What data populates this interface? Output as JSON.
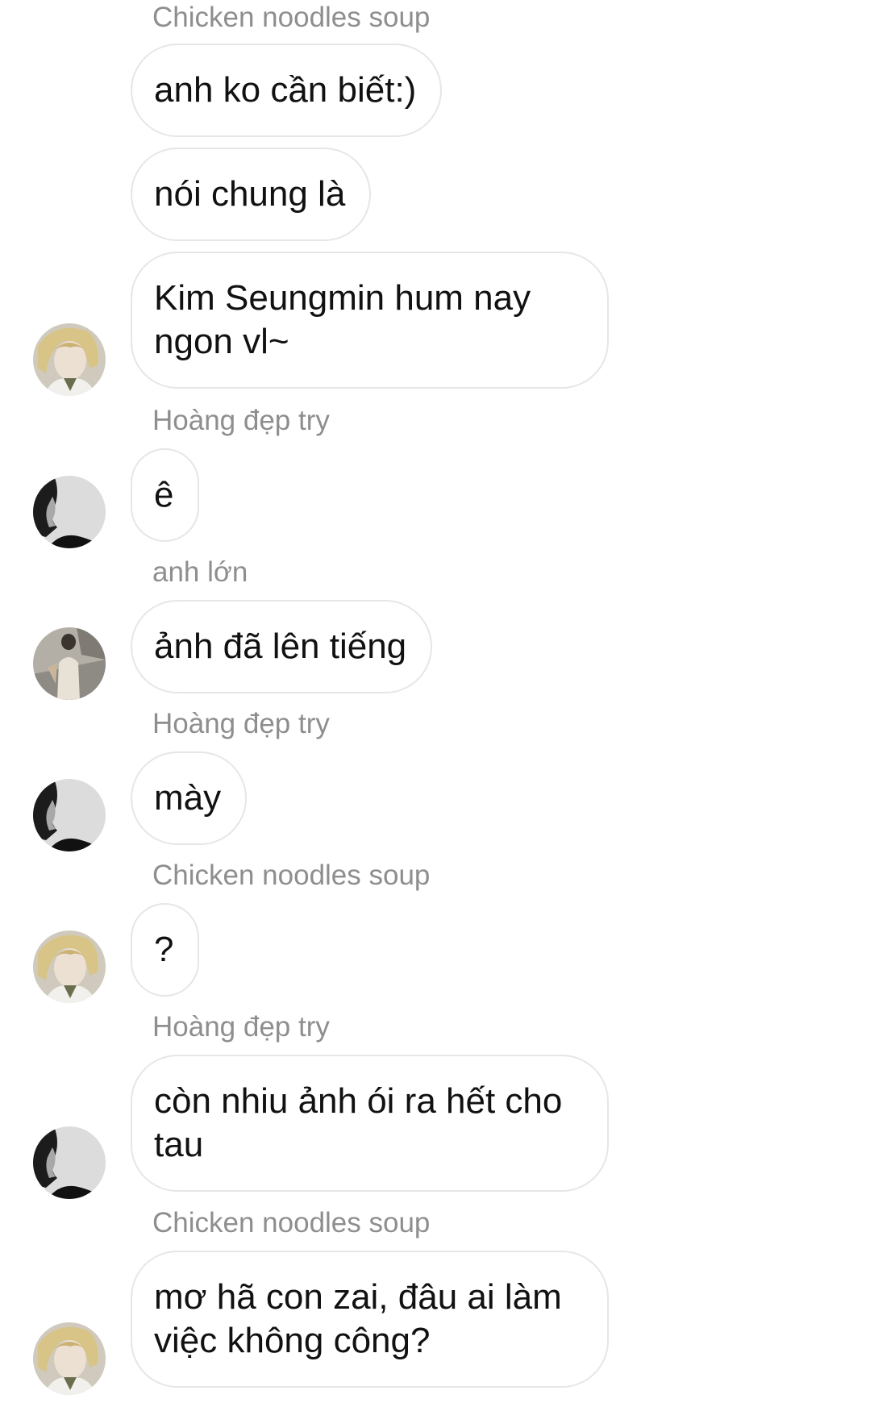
{
  "conversation": {
    "entries": [
      {
        "type": "sender",
        "text": "Chicken noodles soup"
      },
      {
        "type": "message",
        "text": "anh ko cần biết:)"
      },
      {
        "type": "message",
        "text": "nói chung là"
      },
      {
        "type": "message",
        "text": "Kim Seungmin hum nay ngon vl~",
        "avatar": "blonde-portrait-avatar"
      },
      {
        "type": "sender",
        "text": "Hoàng đẹp try"
      },
      {
        "type": "message",
        "text": "ê",
        "avatar": "monochrome-profile-avatar"
      },
      {
        "type": "sender",
        "text": "anh lớn"
      },
      {
        "type": "message",
        "text": "ảnh đã lên tiếng",
        "avatar": "street-photo-avatar"
      },
      {
        "type": "sender",
        "text": "Hoàng đẹp try"
      },
      {
        "type": "message",
        "text": "mày",
        "avatar": "monochrome-profile-avatar"
      },
      {
        "type": "sender",
        "text": "Chicken noodles soup"
      },
      {
        "type": "message",
        "text": "?",
        "avatar": "blonde-portrait-avatar"
      },
      {
        "type": "sender",
        "text": "Hoàng đẹp try"
      },
      {
        "type": "message",
        "text": "còn nhiu ảnh ói ra hết cho tau",
        "avatar": "monochrome-profile-avatar"
      },
      {
        "type": "sender",
        "text": "Chicken noodles soup"
      },
      {
        "type": "message",
        "text": "mơ hã con zai, đâu ai làm việc không công?",
        "avatar": "blonde-portrait-avatar"
      }
    ]
  },
  "theme": {
    "background": "#ffffff",
    "bubble_border": "#e6e6e6",
    "message_text": "#111111",
    "sender_text": "#8e8e8e"
  }
}
